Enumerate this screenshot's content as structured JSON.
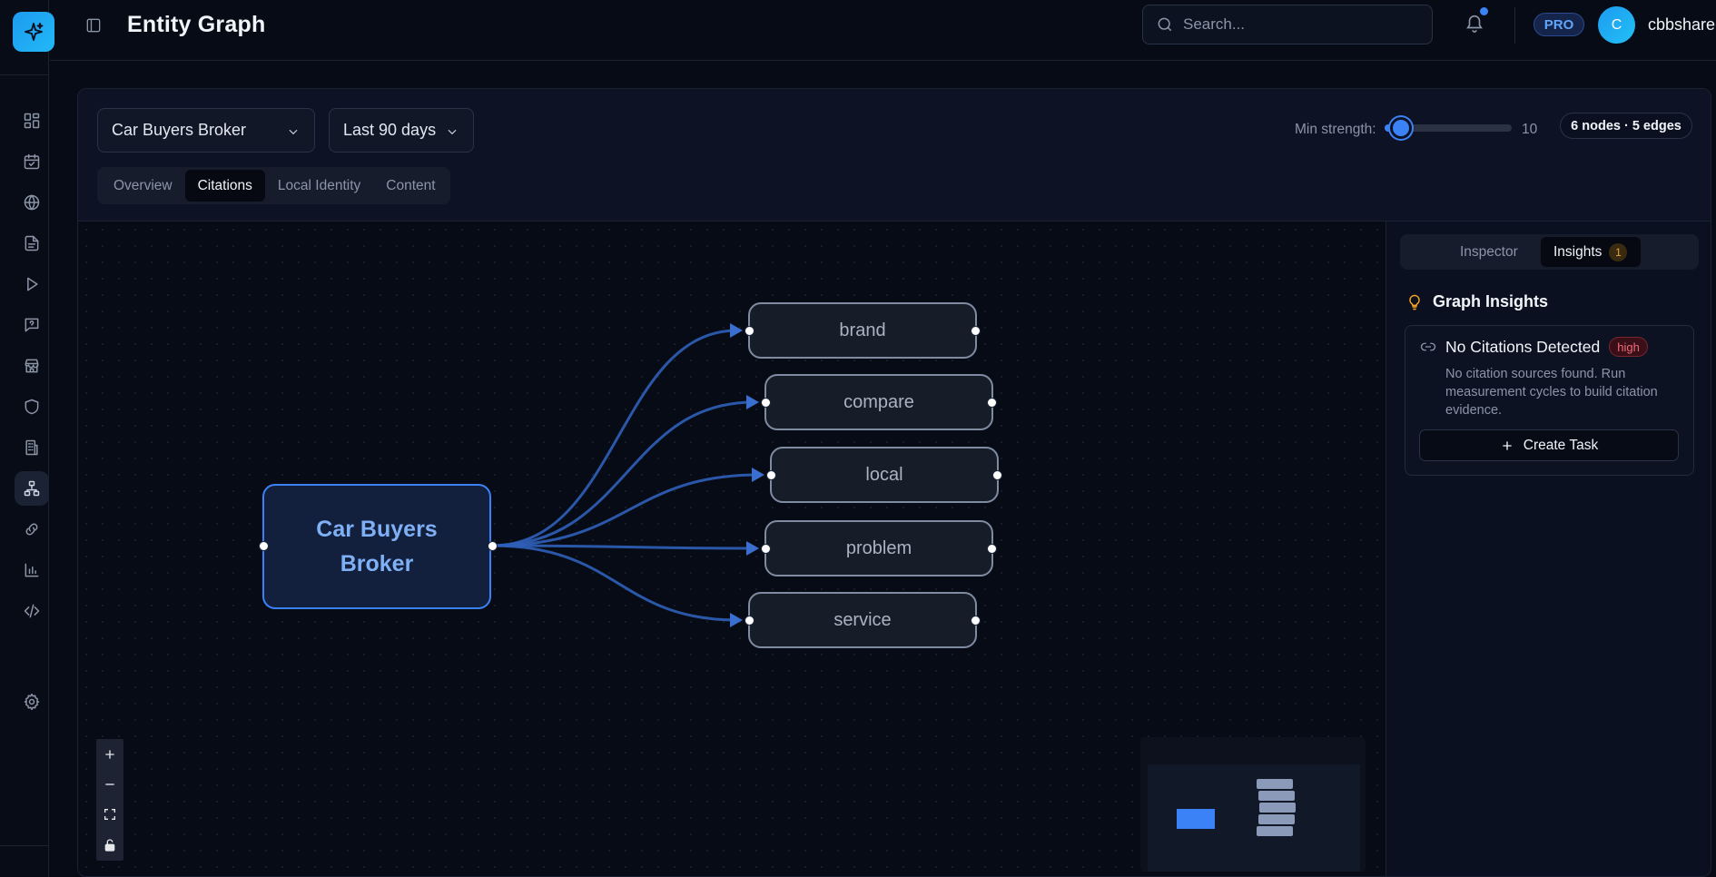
{
  "header": {
    "title": "Entity Graph",
    "search_placeholder": "Search...",
    "plan_badge": "PRO",
    "avatar_initial": "C",
    "username": "cbbshare"
  },
  "rail": {
    "items": [
      {
        "icon": "dashboard-icon",
        "active": false
      },
      {
        "icon": "calendar-check-icon",
        "active": false
      },
      {
        "icon": "globe-icon",
        "active": false
      },
      {
        "icon": "document-icon",
        "active": false
      },
      {
        "icon": "play-icon",
        "active": false
      },
      {
        "icon": "chat-icon",
        "active": false
      },
      {
        "icon": "store-icon",
        "active": false
      },
      {
        "icon": "shield-icon",
        "active": false
      },
      {
        "icon": "building-icon",
        "active": false
      },
      {
        "icon": "entity-graph-icon",
        "active": true
      },
      {
        "icon": "link-icon",
        "active": false
      },
      {
        "icon": "bar-chart-icon",
        "active": false
      },
      {
        "icon": "code-icon",
        "active": false
      }
    ],
    "settings_icon": "gear-icon"
  },
  "toolbar": {
    "entity_select": "Car Buyers Broker",
    "range_select": "Last 90 days",
    "tabs": [
      {
        "label": "Overview",
        "active": false
      },
      {
        "label": "Citations",
        "active": true
      },
      {
        "label": "Local Identity",
        "active": false
      },
      {
        "label": "Content",
        "active": false
      }
    ],
    "min_strength_label": "Min strength:",
    "min_strength_value": 1,
    "min_strength_max": "10",
    "graph_counts": "6 nodes · 5 edges"
  },
  "graph": {
    "center": {
      "label": "Car Buyers Broker"
    },
    "leaves": [
      {
        "label": "brand"
      },
      {
        "label": "compare"
      },
      {
        "label": "local"
      },
      {
        "label": "problem"
      },
      {
        "label": "service"
      }
    ],
    "colors": {
      "edge": "#2f5fb8",
      "center_border": "#3b82f6",
      "leaf_border": "#7f8ba1"
    }
  },
  "panel": {
    "tabs": [
      {
        "label": "Inspector",
        "active": false
      },
      {
        "label": "Insights",
        "active": true,
        "count": "1"
      }
    ],
    "heading": "Graph Insights",
    "insights": [
      {
        "title": "No Citations Detected",
        "severity": "high",
        "description": "No citation sources found. Run measurement cycles to build citation evidence.",
        "action_label": "Create Task"
      }
    ]
  }
}
